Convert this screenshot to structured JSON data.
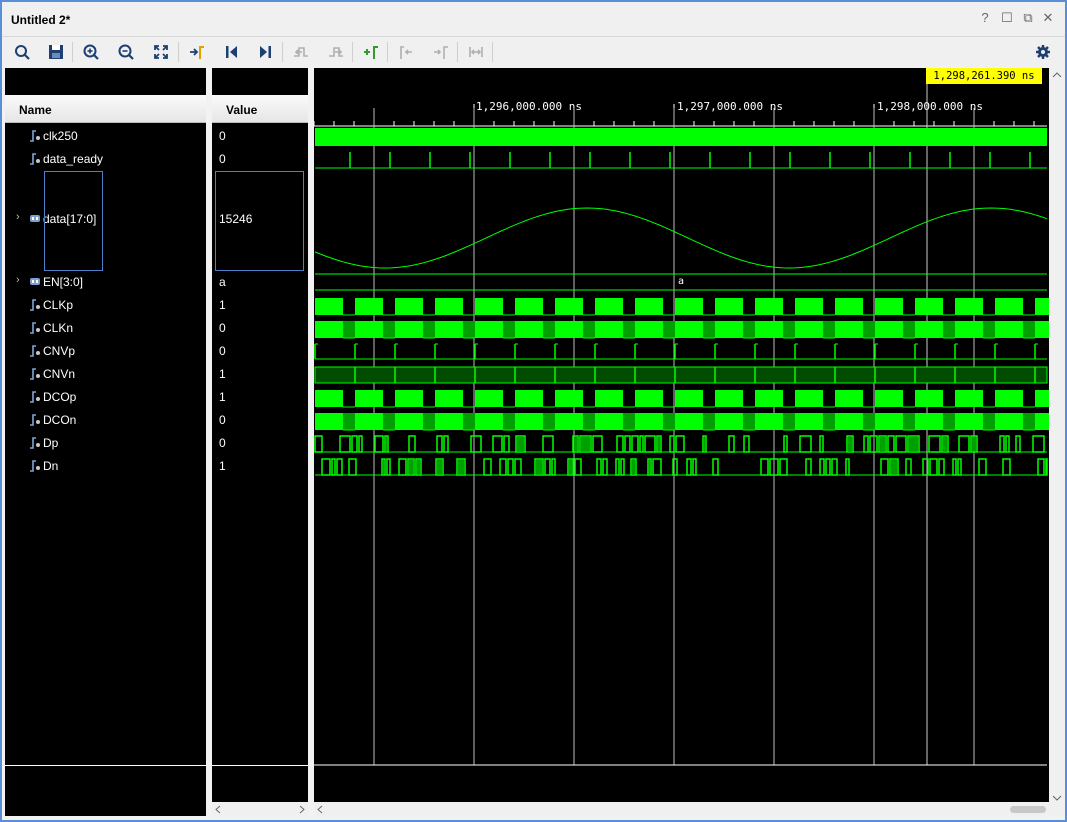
{
  "window": {
    "title": "Untitled 2*"
  },
  "window_controls": [
    "?",
    "☐",
    "⧉",
    "✕"
  ],
  "toolbar": {
    "buttons": [
      "search-icon",
      "save-icon",
      "zoom-in-icon",
      "zoom-out-icon",
      "zoom-fit-icon",
      "go-to-cursor-icon",
      "go-to-start-icon",
      "go-to-end-icon",
      "previous-transition-icon",
      "next-transition-icon",
      "add-marker-icon",
      "previous-marker-icon",
      "next-marker-icon",
      "swap-cursors-icon"
    ],
    "settings": "gear-icon"
  },
  "columns": {
    "name": "Name",
    "value": "Value"
  },
  "signals": [
    {
      "name": "clk250",
      "value": "0",
      "type": "bit"
    },
    {
      "name": "data_ready",
      "value": "0",
      "type": "bit"
    },
    {
      "name": "data[17:0]",
      "value": "15246",
      "type": "bus",
      "expandable": true
    },
    {
      "name": "EN[3:0]",
      "value": "a",
      "type": "bus",
      "expandable": true
    },
    {
      "name": "CLKp",
      "value": "1",
      "type": "bit"
    },
    {
      "name": "CLKn",
      "value": "0",
      "type": "bit"
    },
    {
      "name": "CNVp",
      "value": "0",
      "type": "bit"
    },
    {
      "name": "CNVn",
      "value": "1",
      "type": "bit"
    },
    {
      "name": "DCOp",
      "value": "1",
      "type": "bit"
    },
    {
      "name": "DCOn",
      "value": "0",
      "type": "bit"
    },
    {
      "name": "Dp",
      "value": "0",
      "type": "bit"
    },
    {
      "name": "Dn",
      "value": "1",
      "type": "bit"
    }
  ],
  "timeline": {
    "cursor_time": "1,298,261.390 ns",
    "tick_labels": [
      "1,296,000.000 ns",
      "1,297,000.000 ns",
      "1,298,000.000 ns"
    ],
    "bus_value_en": "a"
  },
  "colors": {
    "wave": "#00ff00",
    "wave_dim": "#00a000",
    "background": "#000000",
    "cursor_label": "#ffff00"
  }
}
